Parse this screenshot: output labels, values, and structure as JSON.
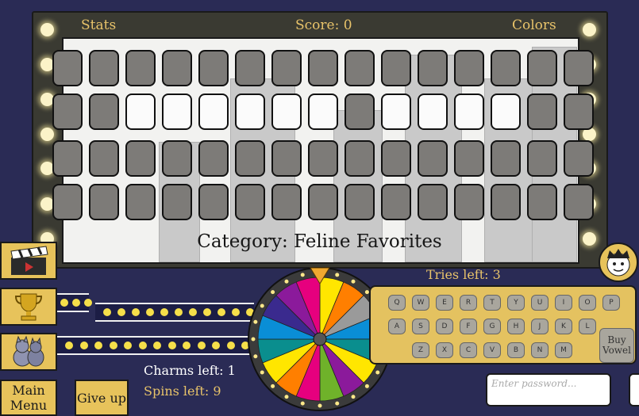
{
  "header": {
    "stats_label": "Stats",
    "score_label": "Score: 0",
    "colors_label": "Colors"
  },
  "board": {
    "rows": [
      [
        "",
        "",
        "",
        "",
        "",
        "",
        "",
        "",
        "",
        "",
        "",
        "",
        "",
        "",
        ""
      ],
      [
        "",
        "",
        "open",
        "open",
        "open",
        "open",
        "open",
        "open",
        "",
        "open",
        "open",
        "open",
        "open",
        "",
        ""
      ],
      [
        "",
        "",
        "",
        "",
        "",
        "",
        "",
        "",
        "",
        "",
        "",
        "",
        "",
        "",
        ""
      ],
      [
        "",
        "",
        "",
        "",
        "",
        "",
        "",
        "",
        "",
        "",
        "",
        "",
        "",
        "",
        ""
      ]
    ]
  },
  "category": "Category: Feline Favorites",
  "tries_left": "Tries left: 3",
  "charms_left": "Charms left: 1",
  "spins_left": "Spins left: 9",
  "main_menu_label": "Main\nMenu",
  "give_up_label": "Give up",
  "keyboard": {
    "row1": [
      "Q",
      "W",
      "E",
      "R",
      "T",
      "Y",
      "U",
      "I",
      "O",
      "P"
    ],
    "row2": [
      "A",
      "S",
      "D",
      "F",
      "G",
      "H",
      "J",
      "K",
      "L"
    ],
    "row3": [
      "Z",
      "X",
      "C",
      "V",
      "B",
      "N",
      "M"
    ],
    "buy_vowel_label": "Buy\nVowel"
  },
  "password_placeholder": "Enter password...",
  "wheel": {
    "colors": [
      "#ffe600",
      "#ff7f00",
      "#9a9a9a",
      "#0a8ed6",
      "#0a8e8e",
      "#ffe600",
      "#8b1a9b",
      "#6fb22a",
      "#e6007e",
      "#ff7f00",
      "#ffe600",
      "#0a8e8e",
      "#0a8ed6",
      "#3a2a8e",
      "#8b1a9b",
      "#e6007e"
    ]
  },
  "accent_colors": {
    "gold": "#e7c35b",
    "background": "#2a2b55",
    "tile": "#7d7b78"
  }
}
